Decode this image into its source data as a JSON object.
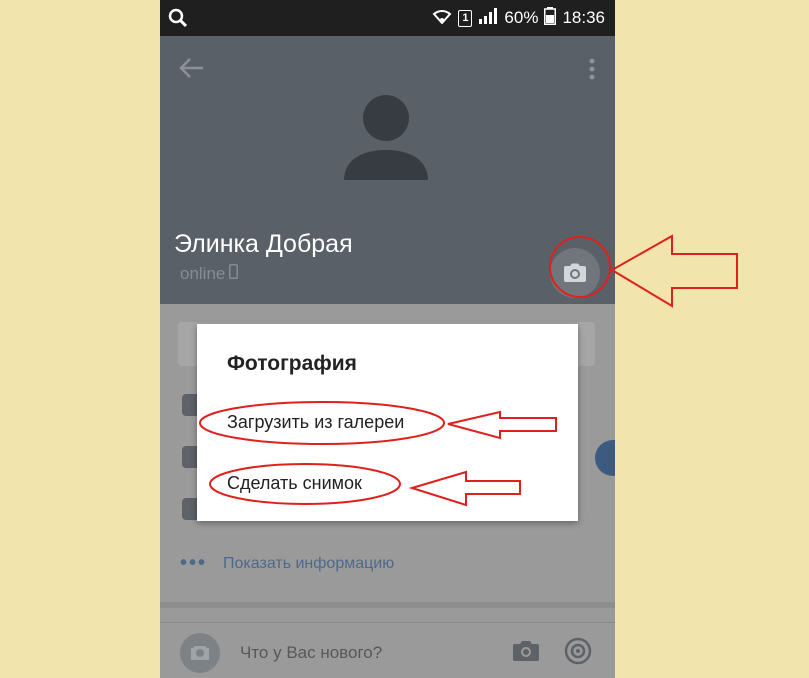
{
  "status_bar": {
    "battery": "60%",
    "time": "18:36",
    "sim": "1"
  },
  "profile": {
    "name": "Элинка Добрая",
    "status": "online"
  },
  "feed": {
    "show_info": "Показать информацию",
    "new_post_placeholder": "Что у Вас нового?"
  },
  "dialog": {
    "title": "Фотография",
    "options": [
      "Загрузить из галереи",
      "Сделать снимок"
    ]
  },
  "colors": {
    "header": "#5a6068",
    "accent": "#4d6a8a",
    "annotation": "#e0201c",
    "backdrop": "#f2e4ad"
  },
  "icons": [
    "search-icon",
    "wifi-icon",
    "signal-icon",
    "battery-icon",
    "back-arrow-icon",
    "more-vert-icon",
    "person-icon",
    "camera-icon",
    "phone-icon",
    "target-icon"
  ]
}
